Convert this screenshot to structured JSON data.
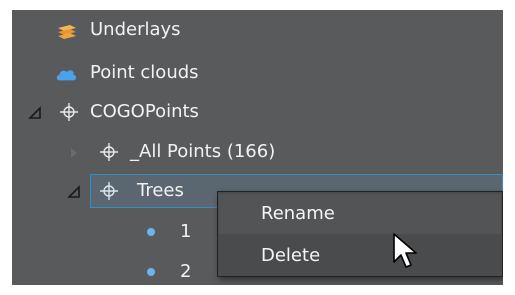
{
  "tree": {
    "items": [
      {
        "label": "Underlays",
        "icon": "underlays-layers-icon"
      },
      {
        "label": "Point clouds",
        "icon": "cloud-icon"
      },
      {
        "label": "COGOPoints",
        "icon": "crosshair-icon",
        "expanded": true
      },
      {
        "label": "_All Points (166)",
        "icon": "crosshair-icon",
        "expanded": false
      },
      {
        "label": "Trees",
        "icon": "crosshair-icon",
        "expanded": true,
        "selected": true
      },
      {
        "label": "1",
        "icon": "point-dot-icon"
      },
      {
        "label": "2",
        "icon": "point-dot-icon"
      }
    ]
  },
  "context_menu": {
    "items": [
      {
        "label": "Rename",
        "hovered": true
      },
      {
        "label": "Delete"
      }
    ]
  },
  "colors": {
    "panel_bg": "#595a5c",
    "selection_border": "#2f8fc6",
    "underlays_icon": "#f0a440",
    "cloud_icon": "#4aa3ea",
    "point_dot": "#6ab4f0"
  }
}
